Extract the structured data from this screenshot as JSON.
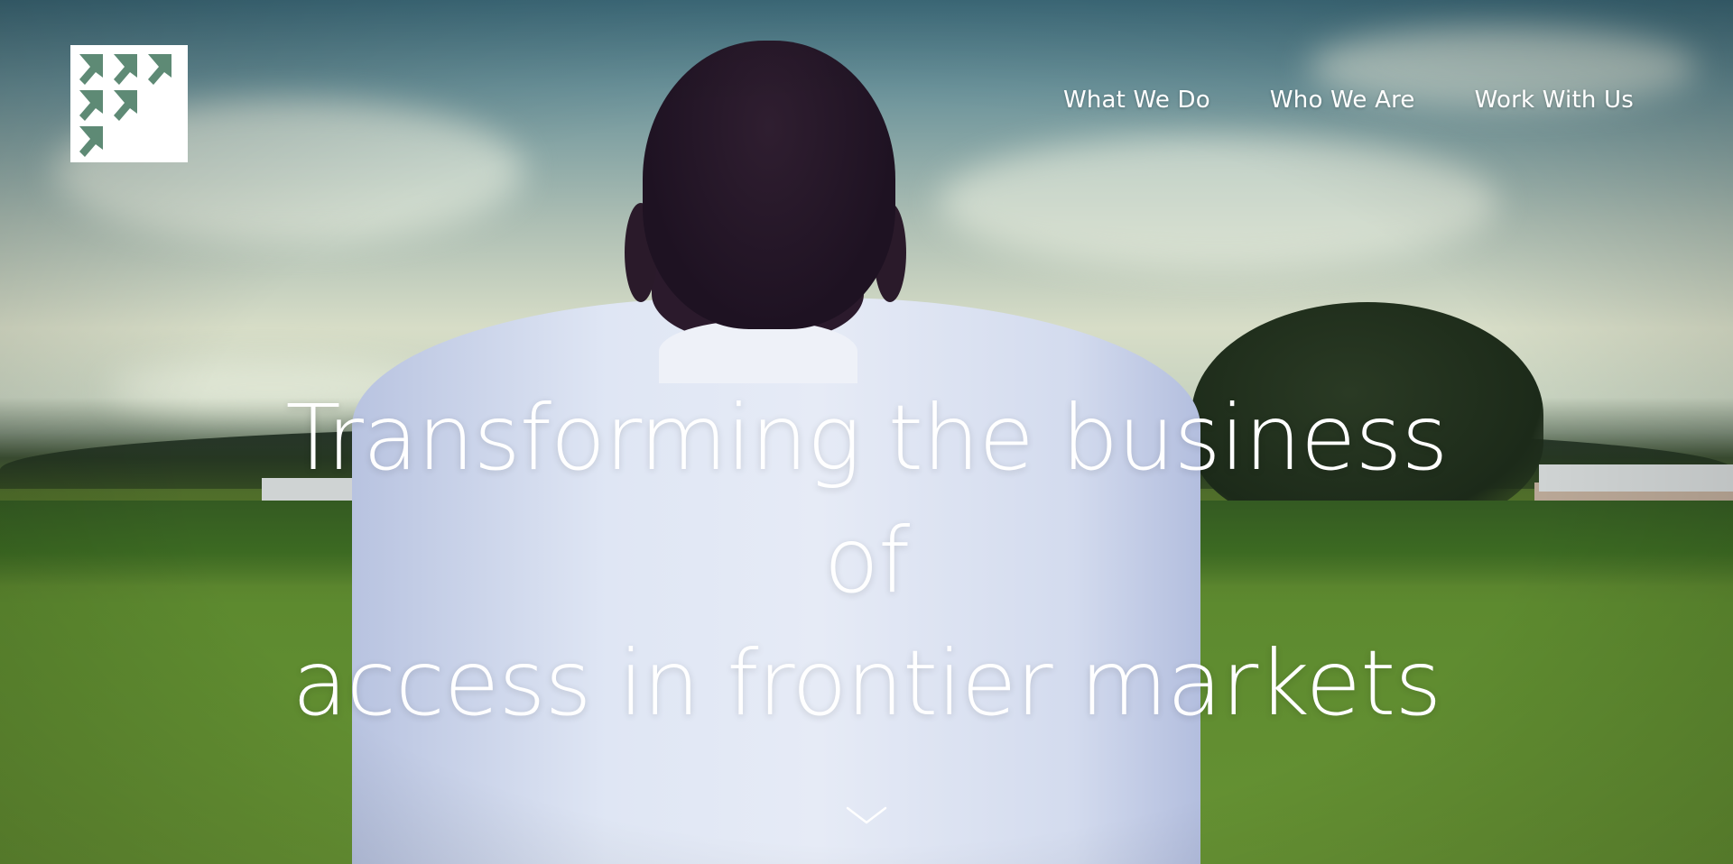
{
  "nav": {
    "items": [
      {
        "label": "What We Do"
      },
      {
        "label": "Who We Are"
      },
      {
        "label": "Work With Us"
      }
    ]
  },
  "hero": {
    "headline_line1": "Transforming the business of",
    "headline_line2": "access in frontier markets"
  },
  "icons": {
    "logo": "arrow-chevrons-logo-icon",
    "scroll": "chevron-down-icon"
  },
  "colors": {
    "logo_background": "#ffffff",
    "logo_mark": "#5e8a75",
    "text": "#ffffff"
  }
}
